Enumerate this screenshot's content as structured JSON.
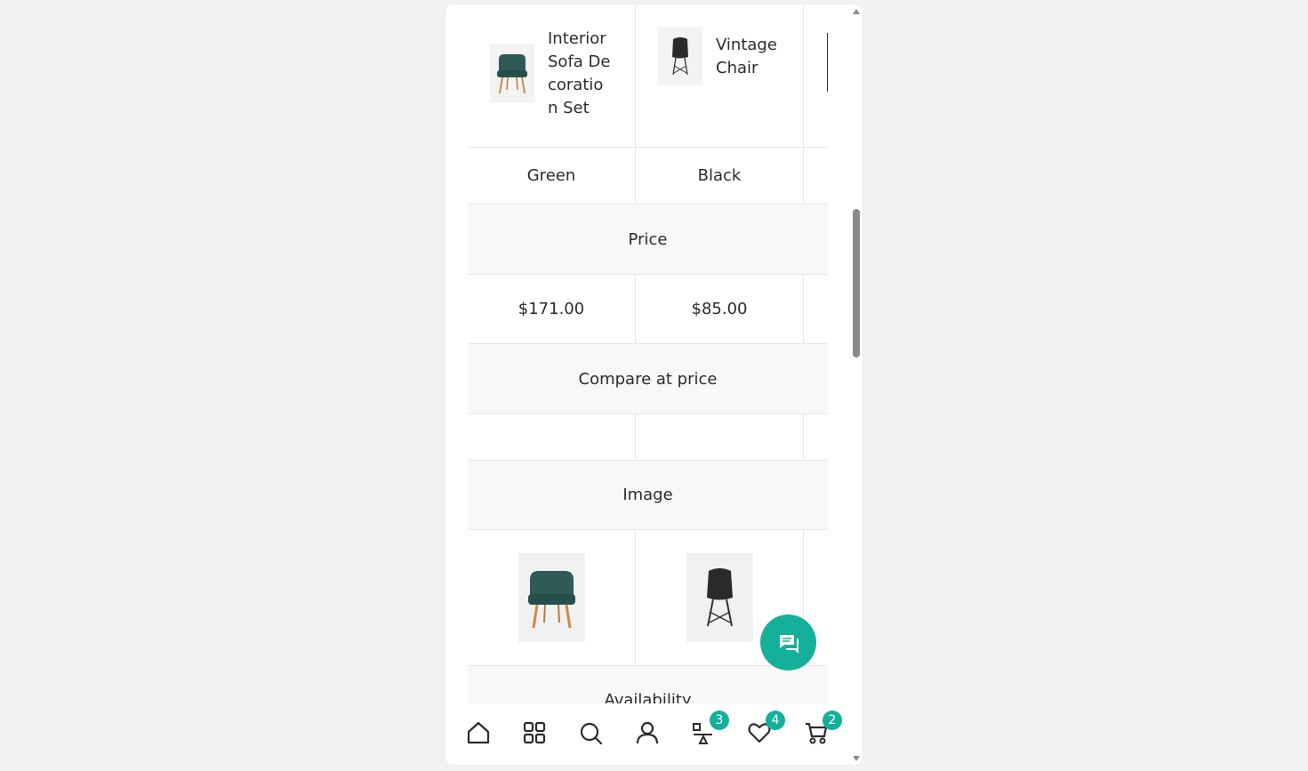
{
  "products": [
    {
      "name": "Interior Sofa De coratio n Set",
      "color": "Green",
      "price": "$171.00",
      "compare_price": "",
      "image_icon": "green-chair-image"
    },
    {
      "name": "Vintage Chair",
      "color": "Black",
      "price": "$85.00",
      "compare_price": "",
      "image_icon": "black-chair-image"
    }
  ],
  "sections": {
    "price": "Price",
    "compare_at_price": "Compare at price",
    "image": "Image",
    "availability": "Availability"
  },
  "bottom_nav": {
    "items": [
      {
        "icon": "home-icon"
      },
      {
        "icon": "grid-icon"
      },
      {
        "icon": "search-icon"
      },
      {
        "icon": "account-icon"
      },
      {
        "icon": "compare-icon",
        "badge": "3"
      },
      {
        "icon": "heart-icon",
        "badge": "4"
      },
      {
        "icon": "cart-icon",
        "badge": "2"
      }
    ]
  },
  "colors": {
    "accent": "#14b09a",
    "chair_green": "#2f5a55",
    "chair_black": "#2a2a2a",
    "wood": "#c98a4a"
  }
}
